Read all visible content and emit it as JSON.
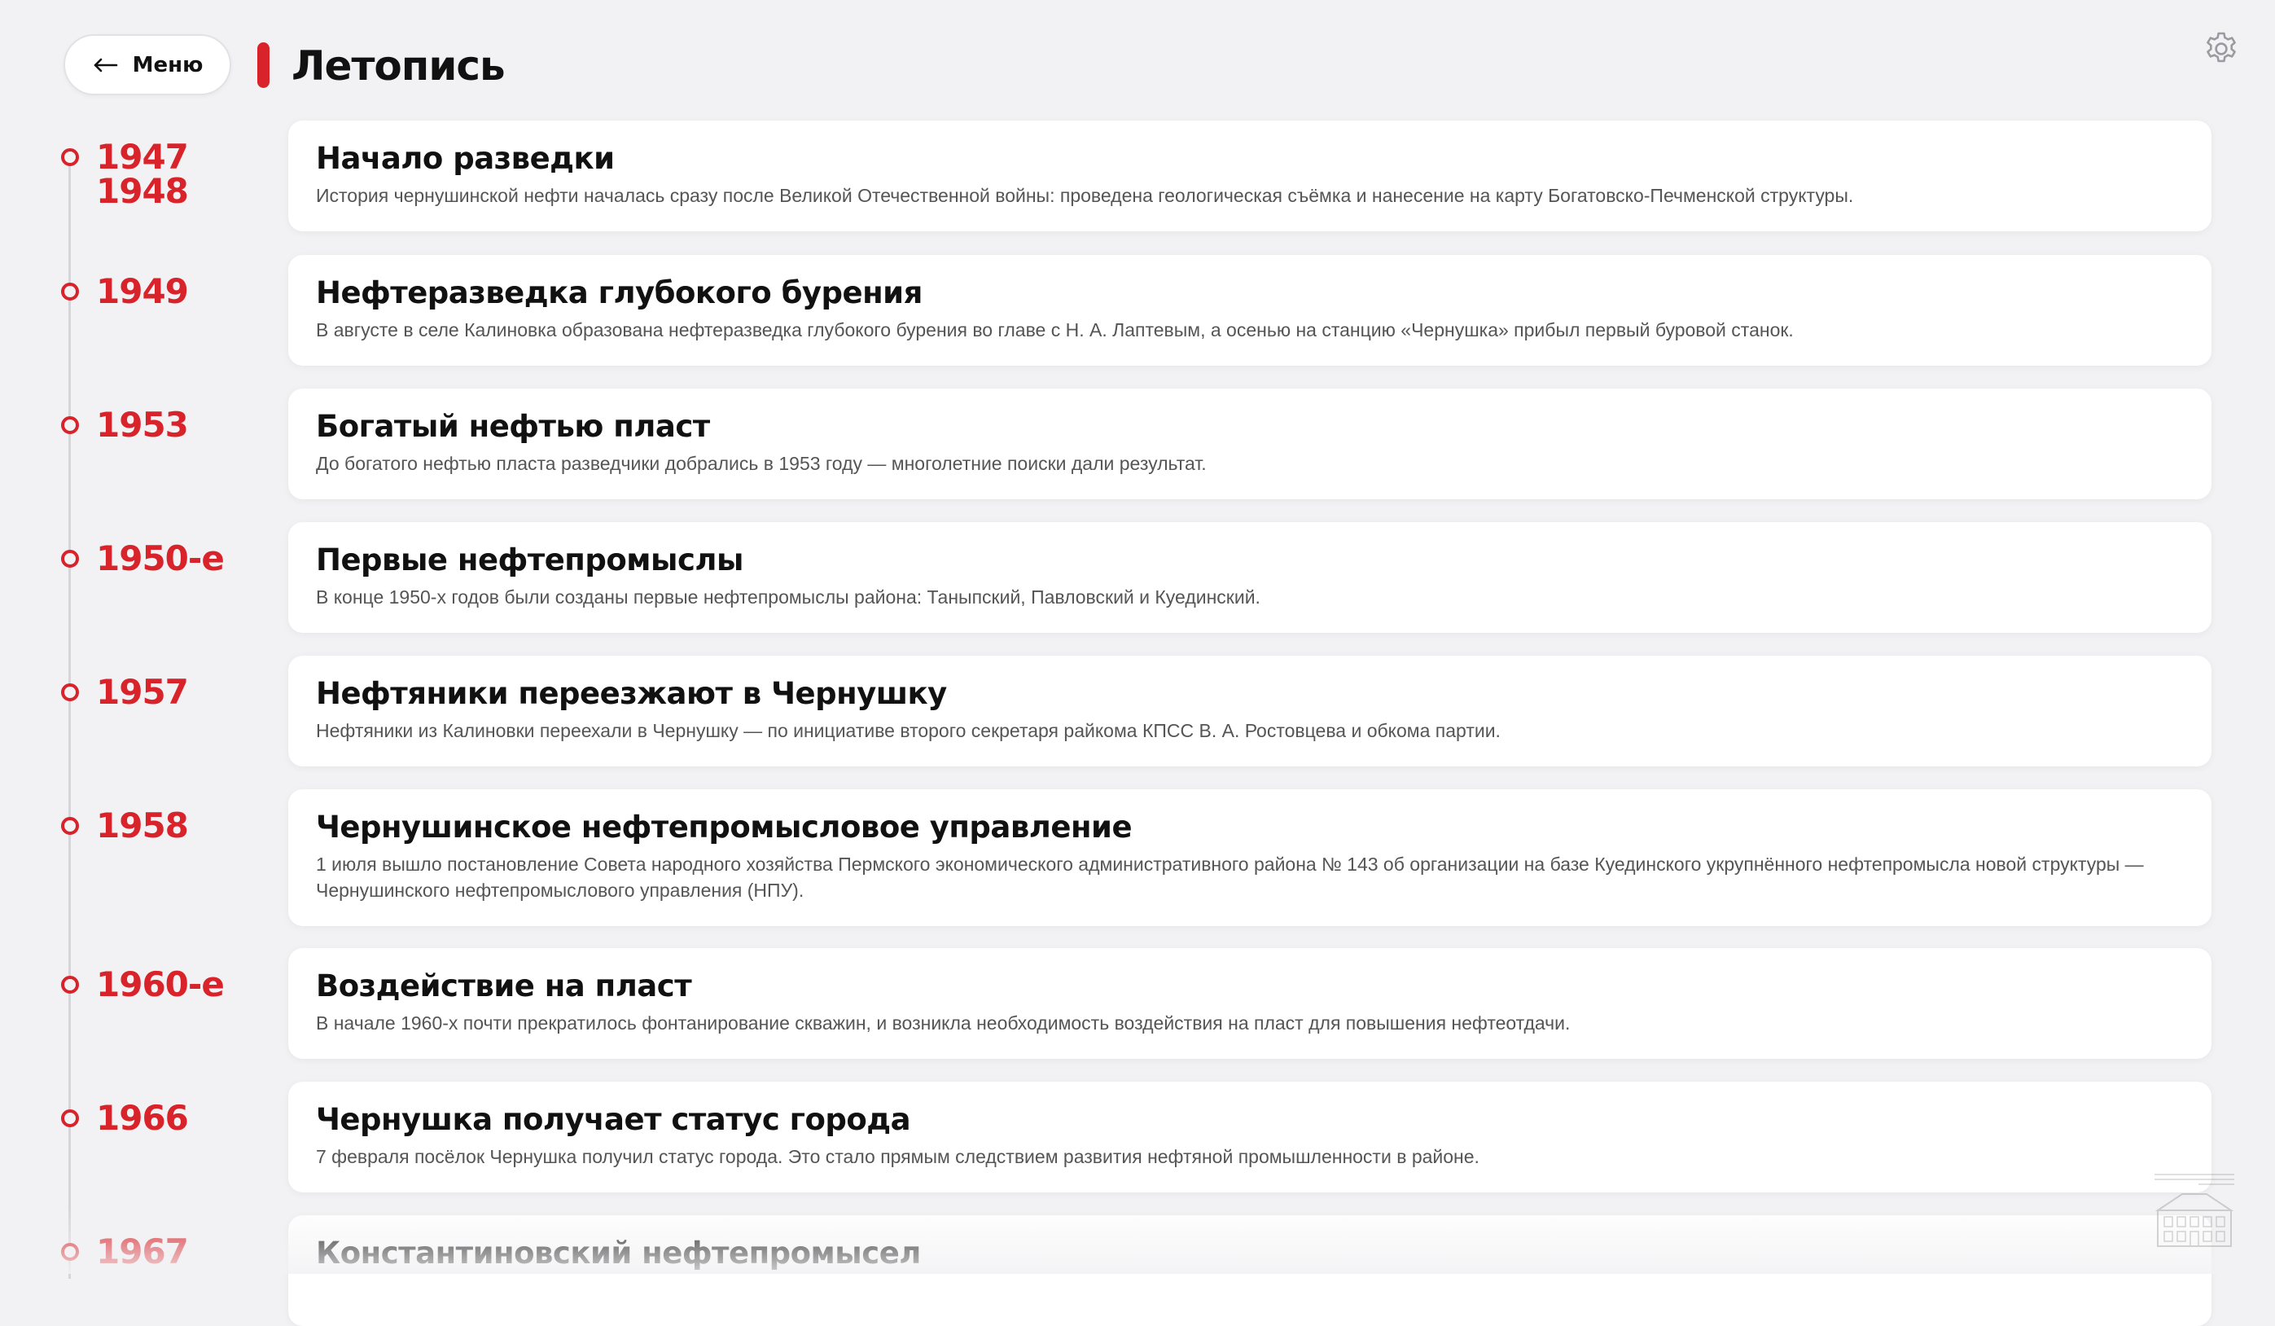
{
  "header": {
    "back_label": "Меню",
    "title": "Летопись"
  },
  "colors": {
    "accent": "#d8232a",
    "background": "#f2f2f4",
    "card": "#ffffff"
  },
  "icons": {
    "back": "arrow-left-icon",
    "settings": "gear-icon",
    "watermark": "museum-building-icon"
  },
  "events": [
    {
      "year": "1947\n1948",
      "title": "Начало разведки",
      "text": "История чернушинской нефти началась сразу после Великой Отечественной войны: проведена геологическая съёмка и нанесение на карту Богатовско-Печменской структуры."
    },
    {
      "year": "1949",
      "title": "Нефтеразведка глубокого бурения",
      "text": "В августе в селе Калиновка образована нефтеразведка глубокого бурения во главе с Н. А. Лаптевым, а осенью на станцию «Чернушка» прибыл первый буровой станок."
    },
    {
      "year": "1953",
      "title": "Богатый нефтью пласт",
      "text": "До богатого нефтью пласта разведчики добрались в 1953 году — многолетние поиски дали результат."
    },
    {
      "year": "1950-е",
      "title": "Первые нефтепромыслы",
      "text": "В конце 1950-х годов были созданы первые нефтепромыслы района: Таныпский, Павловский и Куединский."
    },
    {
      "year": "1957",
      "title": "Нефтяники переезжают в Чернушку",
      "text": "Нефтяники из Калиновки переехали в Чернушку — по инициативе второго секретаря райкома КПСС В. А. Ростовцева и обкома партии."
    },
    {
      "year": "1958",
      "title": "Чернушинское нефтепромысловое управление",
      "text": "1 июля вышло постановление Совета народного хозяйства Пермского экономического административного района № 143 об организации на базе Куединского укрупнённого нефтепромысла новой структуры — Чернушинского нефтепромыслового управления (НПУ)."
    },
    {
      "year": "1960-е",
      "title": "Воздействие на пласт",
      "text": "В начале 1960-х почти прекратилось фонтанирование скважин, и возникла необходимость воздействия на пласт для повышения нефтеотдачи."
    },
    {
      "year": "1966",
      "title": "Чернушка получает статус города",
      "text": "7 февраля посёлок Чернушка получил статус города. Это стало прямым следствием развития нефтяной промышленности в районе."
    },
    {
      "year": "1967",
      "title": "Константиновский нефтепромысел",
      "text": ""
    }
  ]
}
